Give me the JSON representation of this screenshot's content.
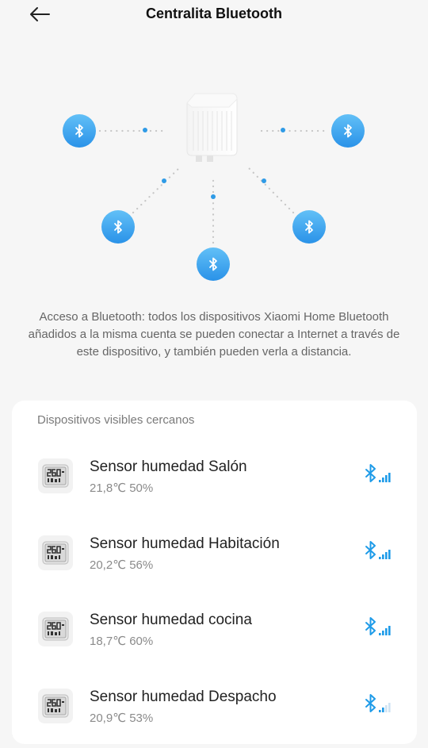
{
  "header": {
    "title": "Centralita Bluetooth",
    "back_icon": "arrow-left-icon"
  },
  "diagram": {
    "hub_icon": "gateway-plug-icon",
    "node_icon": "bluetooth-icon",
    "node_color": "#37a4ef"
  },
  "description": "Acceso a Bluetooth: todos los dispositivos Xiaomi Home Bluetooth añadidos a la misma cuenta se pueden conectar a Internet a través de este dispositivo, y también pueden verla a distancia.",
  "devices_section": {
    "label": "Dispositivos visibles cercanos",
    "devices": [
      {
        "name": "Sensor humedad Salón",
        "status": "21,8℃ 50%",
        "signal_bars": 4
      },
      {
        "name": "Sensor humedad Habitación",
        "status": "20,2℃ 56%",
        "signal_bars": 4
      },
      {
        "name": "Sensor humedad cocina",
        "status": "18,7℃ 60%",
        "signal_bars": 4
      },
      {
        "name": "Sensor humedad Despacho",
        "status": "20,9℃ 53%",
        "signal_bars": 2
      }
    ]
  },
  "colors": {
    "accent": "#1e9be8",
    "signal_inactive": "#cfe3f2"
  }
}
